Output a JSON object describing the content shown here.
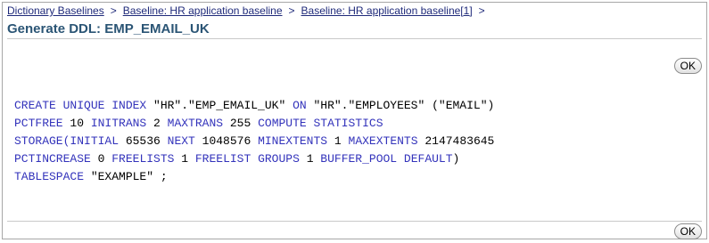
{
  "breadcrumb": {
    "items": [
      "Dictionary Baselines",
      "Baseline: HR application baseline",
      "Baseline: HR application baseline[1]"
    ],
    "separator": ">"
  },
  "page_title": "Generate DDL: EMP_EMAIL_UK",
  "buttons": {
    "ok_top": "OK",
    "ok_bottom": "OK"
  },
  "ddl": {
    "line1": {
      "k1": "CREATE UNIQUE INDEX ",
      "v1": "\"HR\".\"EMP_EMAIL_UK\" ",
      "k2": "ON ",
      "v2": "\"HR\".\"EMPLOYEES\" (\"EMAIL\")"
    },
    "line2": {
      "k1": "PCTFREE ",
      "v1": "10 ",
      "k2": "INITRANS ",
      "v2": "2 ",
      "k3": "MAXTRANS ",
      "v3": "255 ",
      "k4": "COMPUTE STATISTICS"
    },
    "line3": {
      "k1": "STORAGE(INITIAL ",
      "v1": "65536 ",
      "k2": "NEXT ",
      "v2": "1048576 ",
      "k3": "MINEXTENTS ",
      "v3": "1 ",
      "k4": "MAXEXTENTS ",
      "v4": "2147483645"
    },
    "line4": {
      "k1": "PCTINCREASE ",
      "v1": "0 ",
      "k2": "FREELISTS ",
      "v2": "1 ",
      "k3": "FREELIST GROUPS ",
      "v3": "1 ",
      "k4": "BUFFER_POOL DEFAULT",
      "v4": ")"
    },
    "line5": {
      "k1": "TABLESPACE ",
      "v1": "\"EXAMPLE\" ;"
    }
  },
  "colors": {
    "keyword": "#3333bb",
    "value": "#000000",
    "title": "#2b5575",
    "link": "#1f2a7a"
  }
}
